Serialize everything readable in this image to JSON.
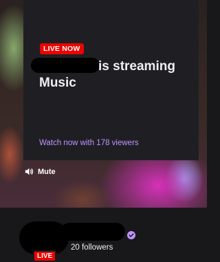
{
  "offline_card": {
    "badge": "LIVE NOW",
    "title_line1": "is streaming",
    "title_line2": "Music",
    "watch_text": "Watch now with 178 viewers"
  },
  "player": {
    "mute_label": "Mute",
    "mute_icon": "speaker-icon"
  },
  "channel": {
    "followers_text": "20 followers",
    "live_badge": "LIVE",
    "verified_icon": "verified-icon"
  },
  "colors": {
    "live_red": "#eb0400",
    "accent_purple": "#bf94ff",
    "card_bg": "#1f1f23",
    "page_bg": "#18181b"
  }
}
